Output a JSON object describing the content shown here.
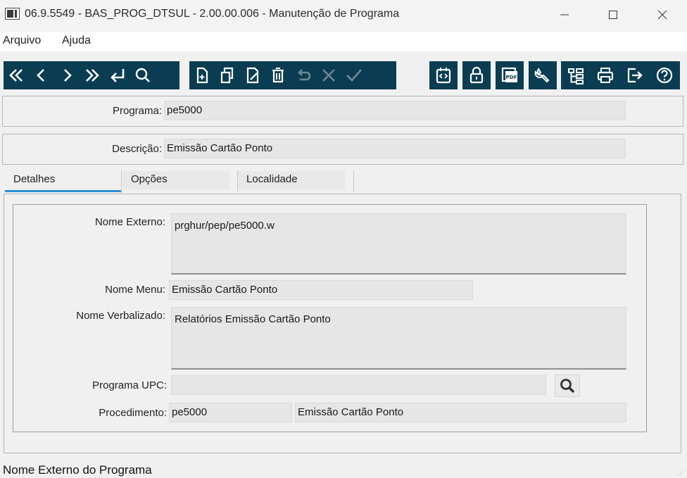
{
  "window": {
    "title": "06.9.5549 - BAS_PROG_DTSUL - 2.00.00.006 - Manutenção de Programa"
  },
  "menu": {
    "items": [
      "Arquivo",
      "Ajuda"
    ]
  },
  "toolbar": {
    "nav": [
      "first-icon",
      "previous-icon",
      "next-icon",
      "last-icon",
      "goto-icon",
      "search-icon"
    ],
    "edit": [
      "new-icon",
      "copy-icon",
      "edit-icon",
      "delete-icon",
      "undo-icon",
      "cancel-icon",
      "save-icon"
    ],
    "tools": [
      "query-icon",
      "lock-icon",
      "pdf-icon",
      "wrench-icon",
      "tree-icon",
      "print-icon",
      "exit-icon",
      "help-icon"
    ]
  },
  "header": {
    "programa_label": "Programa:",
    "programa_value": "pe5000",
    "descricao_label": "Descrição:",
    "descricao_value": "Emissão Cartão Ponto"
  },
  "tabs": [
    {
      "label": "Detalhes",
      "active": true
    },
    {
      "label": "Opções",
      "active": false
    },
    {
      "label": "Localidade",
      "active": false
    }
  ],
  "details": {
    "nome_externo_label": "Nome Externo:",
    "nome_externo_value": "prghur/pep/pe5000.w",
    "nome_menu_label": "Nome Menu:",
    "nome_menu_value": "Emissão Cartão Ponto",
    "nome_verbalizado_label": "Nome Verbalizado:",
    "nome_verbalizado_value": "Relatórios Emissão Cartão Ponto",
    "programa_upc_label": "Programa UPC:",
    "programa_upc_value": "",
    "procedimento_label": "Procedimento:",
    "procedimento_code": "pe5000",
    "procedimento_desc": "Emissão Cartão Ponto"
  },
  "status": {
    "text": "Nome Externo do Programa"
  },
  "colors": {
    "toolbar_bg": "#0b3d52",
    "tab_accent": "#2b8fd6"
  }
}
